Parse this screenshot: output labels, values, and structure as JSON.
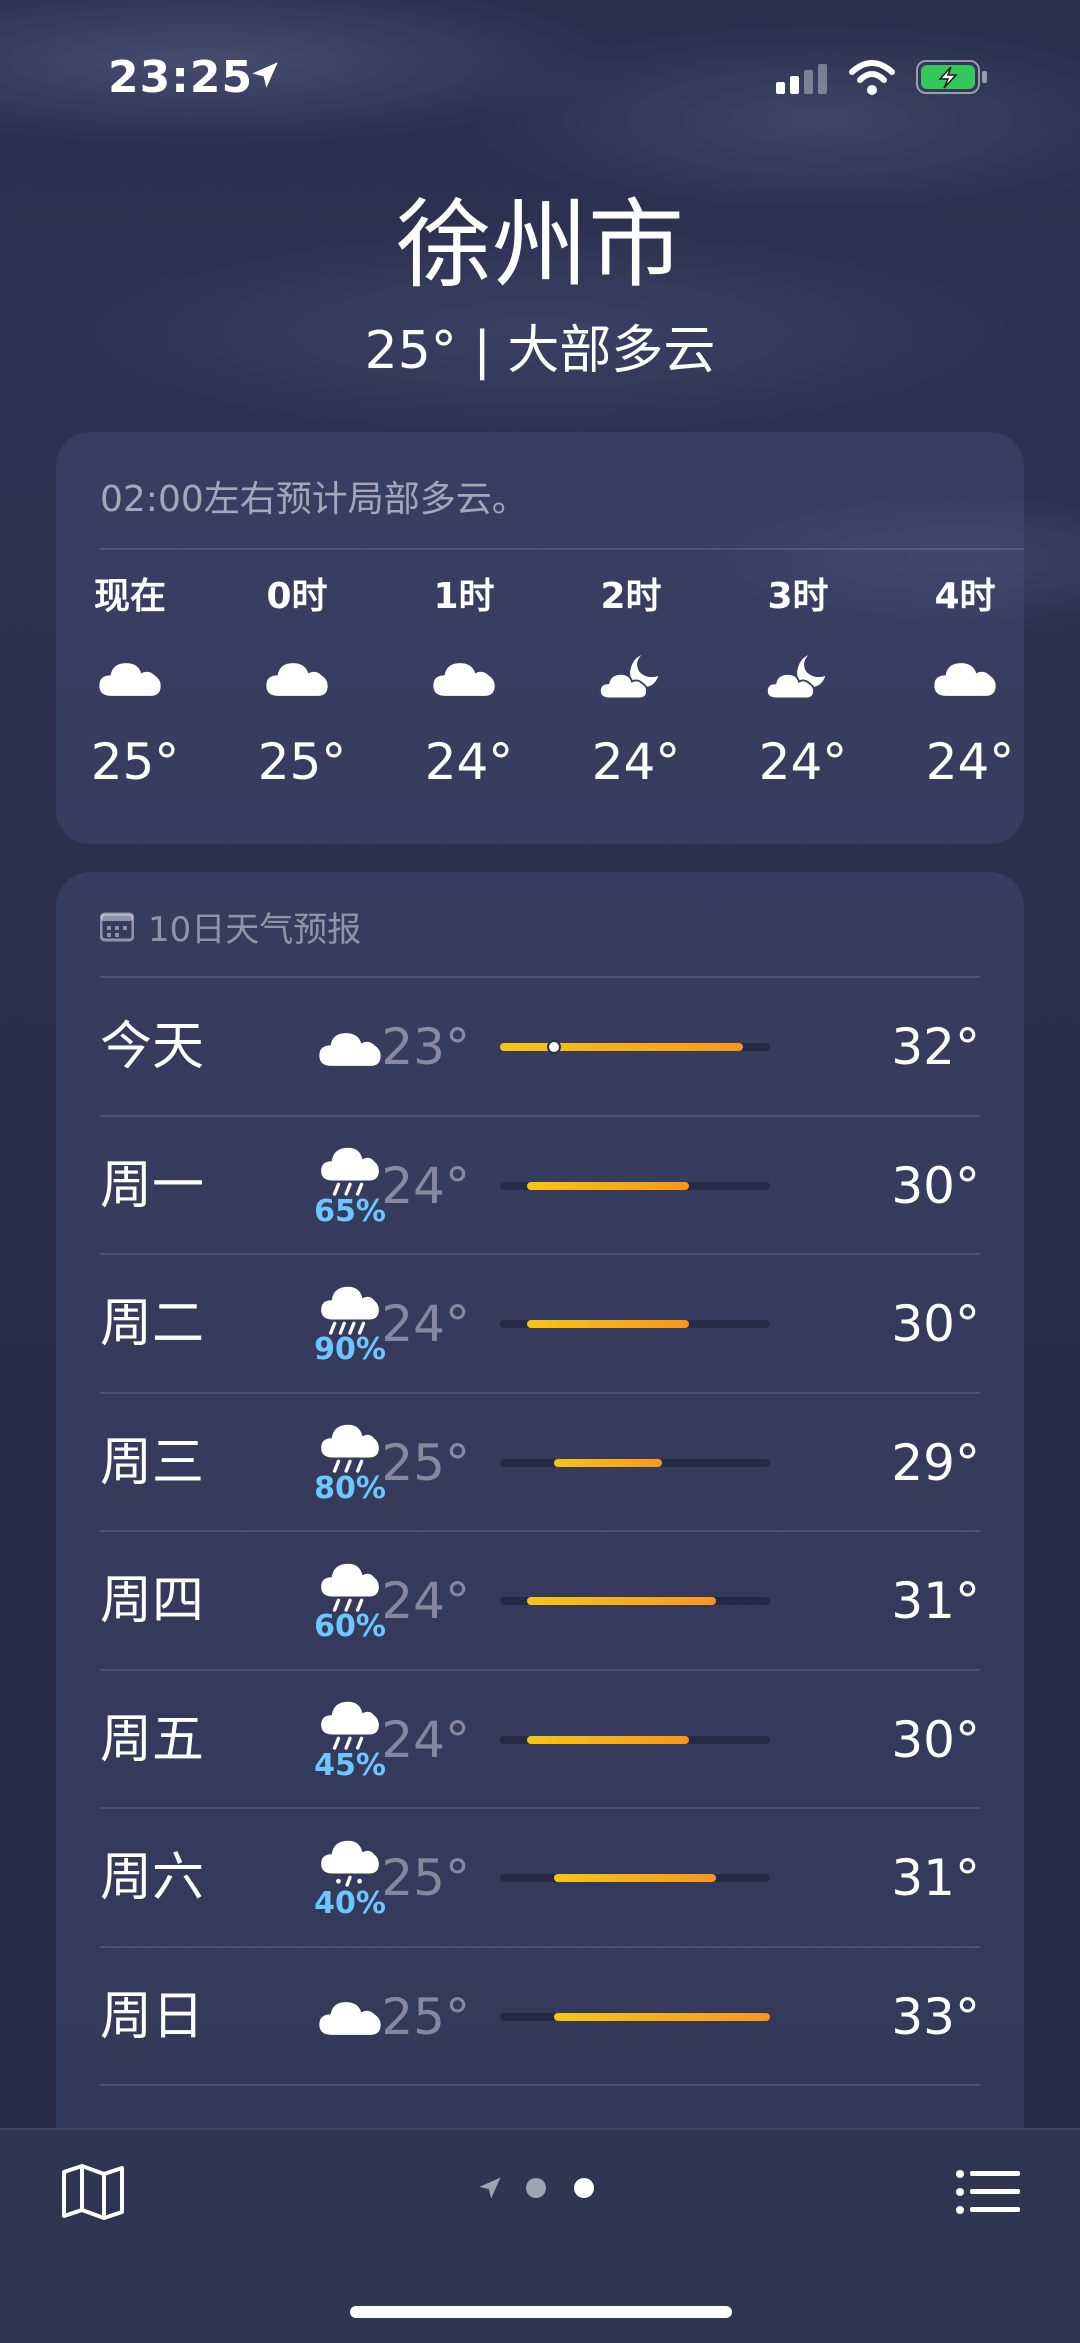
{
  "status": {
    "time": "23:25"
  },
  "header": {
    "city": "徐州市",
    "summary": "25° | 大部多云"
  },
  "hourly": {
    "note": "02:00左右预计局部多云。",
    "hours": [
      {
        "label": "现在",
        "icon": "cloud-icon",
        "temp": "25°"
      },
      {
        "label": "0时",
        "icon": "cloud-icon",
        "temp": "25°"
      },
      {
        "label": "1时",
        "icon": "cloud-icon",
        "temp": "24°"
      },
      {
        "label": "2时",
        "icon": "moon-cloud-icon",
        "temp": "24°"
      },
      {
        "label": "3时",
        "icon": "moon-cloud-icon",
        "temp": "24°"
      },
      {
        "label": "4时",
        "icon": "cloud-icon",
        "temp": "24°"
      }
    ]
  },
  "daily": {
    "title": "10日天气预报",
    "range_min": 23,
    "range_max": 33,
    "current_temp": 25,
    "days": [
      {
        "day": "今天",
        "icon": "cloud-icon",
        "pct": "",
        "low": "23°",
        "high": "32°",
        "low_v": 23,
        "high_v": 32
      },
      {
        "day": "周一",
        "icon": "rain-icon",
        "pct": "65%",
        "low": "24°",
        "high": "30°",
        "low_v": 24,
        "high_v": 30
      },
      {
        "day": "周二",
        "icon": "heavy-rain-icon",
        "pct": "90%",
        "low": "24°",
        "high": "30°",
        "low_v": 24,
        "high_v": 30
      },
      {
        "day": "周三",
        "icon": "rain-icon",
        "pct": "80%",
        "low": "25°",
        "high": "29°",
        "low_v": 25,
        "high_v": 29
      },
      {
        "day": "周四",
        "icon": "rain-icon",
        "pct": "60%",
        "low": "24°",
        "high": "31°",
        "low_v": 24,
        "high_v": 31
      },
      {
        "day": "周五",
        "icon": "rain-icon",
        "pct": "45%",
        "low": "24°",
        "high": "30°",
        "low_v": 24,
        "high_v": 30
      },
      {
        "day": "周六",
        "icon": "drizzle-icon",
        "pct": "40%",
        "low": "25°",
        "high": "31°",
        "low_v": 25,
        "high_v": 31
      },
      {
        "day": "周日",
        "icon": "cloud-icon",
        "pct": "",
        "low": "25°",
        "high": "33°",
        "low_v": 25,
        "high_v": 33
      }
    ]
  },
  "colors": {
    "precip": "#6ec6ff",
    "bar_start": "#f6c514",
    "bar_end": "#f7971e"
  }
}
